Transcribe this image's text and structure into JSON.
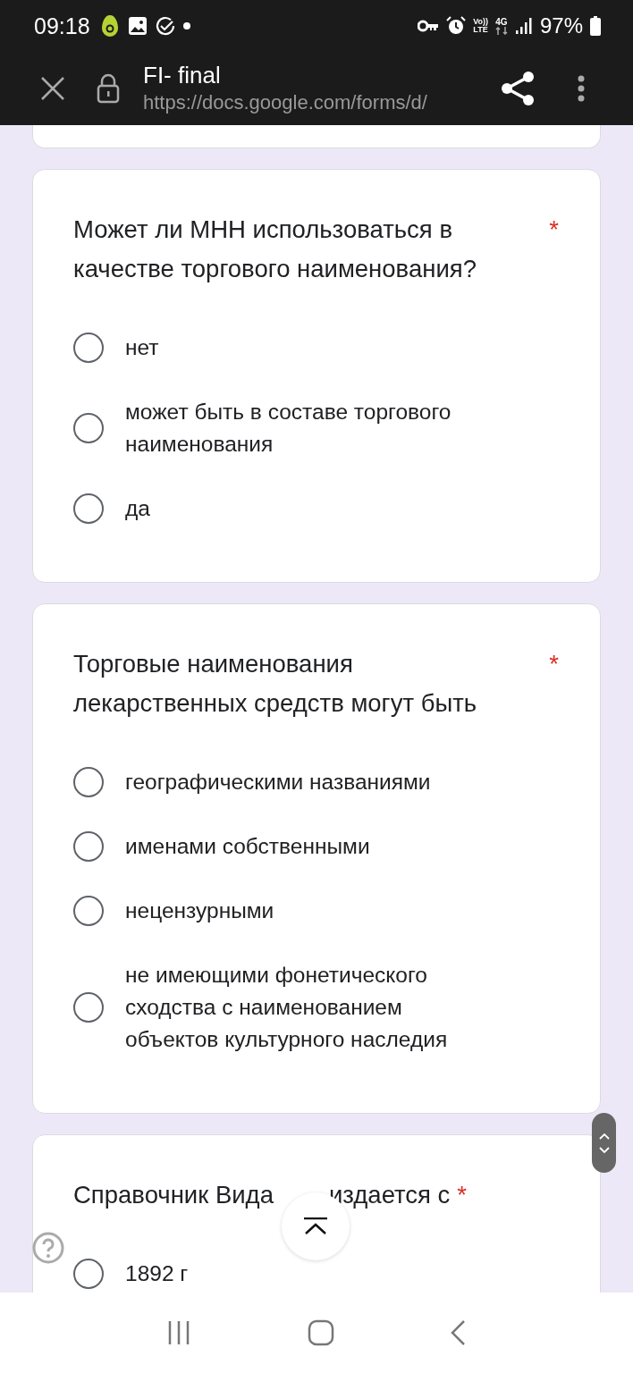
{
  "status_bar": {
    "time": "09:18",
    "volte": [
      "Vo))",
      "LTE"
    ],
    "network": "4G",
    "battery": "97%"
  },
  "toolbar": {
    "title": "FI- final",
    "url": "https://docs.google.com/forms/d/"
  },
  "questions": [
    {
      "title": [
        "Может ли МНН использоваться в качестве торгового наименования?"
      ],
      "required_mark": "*",
      "options": [
        {
          "label": "нет",
          "selected": false
        },
        {
          "label": "может быть в составе торгового наименования",
          "selected": false
        },
        {
          "label": "да",
          "selected": false
        }
      ]
    },
    {
      "title": [
        "Торговые наименования лекарственных средств могут быть"
      ],
      "required_mark": "*",
      "options": [
        {
          "label": "географическими названиями",
          "selected": false
        },
        {
          "label": "именами собственными",
          "selected": false
        },
        {
          "label": "нецензурными",
          "selected": false
        },
        {
          "label": "не имеющими фонетического сходства с наименованием объектов культурного наследия",
          "selected": false
        }
      ]
    },
    {
      "title": [
        "Справочник Вида",
        "издается с"
      ],
      "required_mark": "*",
      "options": [
        {
          "label": "1892 г",
          "selected": false
        }
      ]
    }
  ]
}
